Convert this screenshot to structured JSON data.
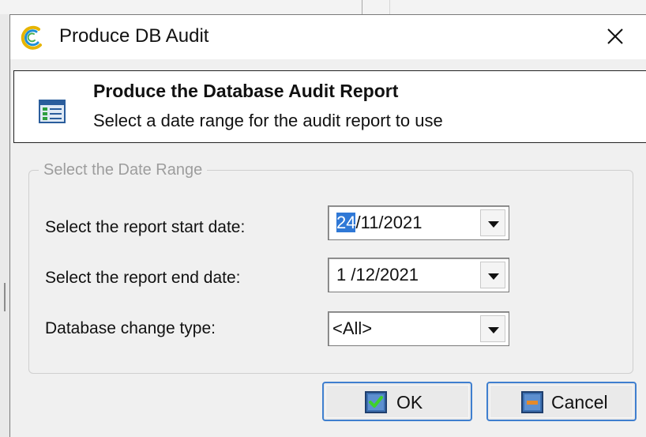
{
  "window": {
    "title": "Produce DB Audit",
    "close_glyph": "✕"
  },
  "header": {
    "title": "Produce the Database Audit Report",
    "subtitle": "Select a date range for the audit report to use",
    "icon": "report-list-icon"
  },
  "date_range": {
    "legend": "Select the Date Range",
    "start_label": "Select the report start date:",
    "start_value_selected": "24",
    "start_value_rest": "/11/2021",
    "end_label": "Select the report end date:",
    "end_value": "1 /12/2021",
    "change_type_label": "Database change type:",
    "change_type_value": "<All>"
  },
  "buttons": {
    "ok_label": "OK",
    "cancel_label": "Cancel"
  },
  "colors": {
    "accent": "#3f7fcf",
    "selection": "#2f78d6",
    "disabled_text": "#9d9d9d"
  }
}
